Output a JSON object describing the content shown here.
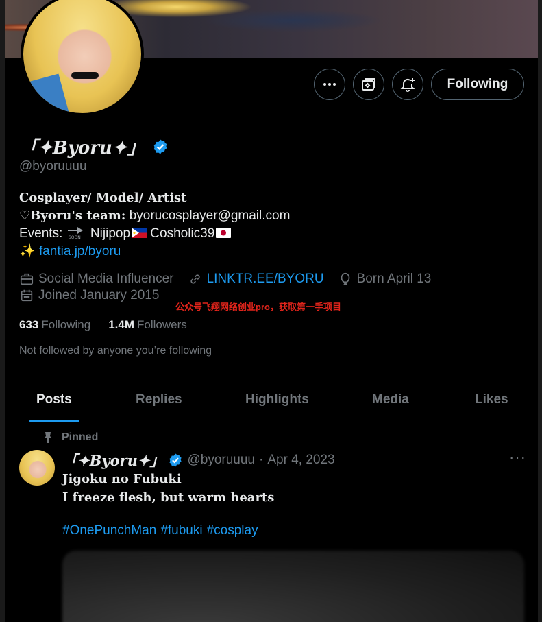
{
  "colors": {
    "accent": "#1d9bf0",
    "muted": "#71767b",
    "text": "#e7e9ea",
    "border": "#536471",
    "watermark": "#e0241b"
  },
  "actions": {
    "more_icon": "more-horizontal-icon",
    "subscribe_icon": "subscribe-icon",
    "notify_icon": "bell-plus-icon",
    "follow_label": "Following"
  },
  "profile": {
    "name": "「✦𝑩𝒚𝒐𝒓𝒖✦」",
    "handle": "@byoruuuu",
    "bio_line1": "Cosplayer/ Model/ Artist",
    "bio_line2_bold": "♡Byoru's team:",
    "bio_line2_rest": " byorucosplayer@gmail.com",
    "bio_line3_prefix": "Events:",
    "bio_line3_a": " Nijipop",
    "bio_line3_b": " Cosholic39",
    "bio_line4_emoji": "✨",
    "bio_link": "fantia.jp/byoru",
    "category": "Social Media Influencer",
    "website": "LINKTR.EE/BYORU",
    "birthday": "Born April 13",
    "joined": "Joined January 2015",
    "following_count": "633",
    "following_label": "Following",
    "followers_count": "1.4M",
    "followers_label": "Followers",
    "not_followed": "Not followed by anyone you’re following"
  },
  "watermark": "公众号飞翔网络创业pro，获取第一手项目",
  "tabs": [
    "Posts",
    "Replies",
    "Highlights",
    "Media",
    "Likes"
  ],
  "post": {
    "pinned_label": "Pinned",
    "author": "「✦𝑩𝒚𝒐𝒓𝒖✦」",
    "handle": "@byoruuuu",
    "sep": "·",
    "date": "Apr 4, 2023",
    "more": "···",
    "line1": "Jigoku no Fubuki",
    "line2": "I freeze flesh, but warm hearts",
    "hashtags": [
      "#OnePunchMan",
      "#fubuki",
      "#cosplay"
    ]
  }
}
